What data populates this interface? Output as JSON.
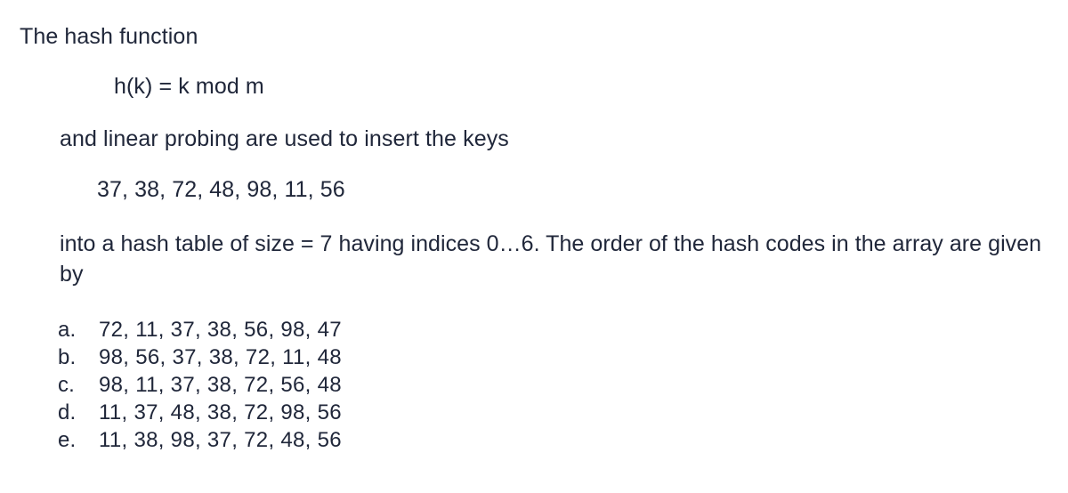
{
  "question": {
    "intro": "The hash function",
    "formula": "h(k) = k mod m",
    "probing": "and linear probing are used to insert the keys",
    "keys": "37, 38, 72, 48, 98, 11, 56",
    "body": "into a hash table of size = 7 having indices 0…6. The order of the hash codes in the array are given by",
    "table_size": "7",
    "index_range": "0…6"
  },
  "options": [
    {
      "marker": "a.",
      "text": "72, 11, 37, 38, 56, 98, 47"
    },
    {
      "marker": "b.",
      "text": "98, 56, 37, 38, 72, 11, 48"
    },
    {
      "marker": "c.",
      "text": "98, 11, 37, 38, 72, 56, 48"
    },
    {
      "marker": "d.",
      "text": "11, 37, 48, 38, 72, 98, 56"
    },
    {
      "marker": "e.",
      "text": "11, 38, 98, 37, 72, 48, 56"
    }
  ],
  "colors": {
    "text": "#20273a",
    "background": "#ffffff"
  }
}
